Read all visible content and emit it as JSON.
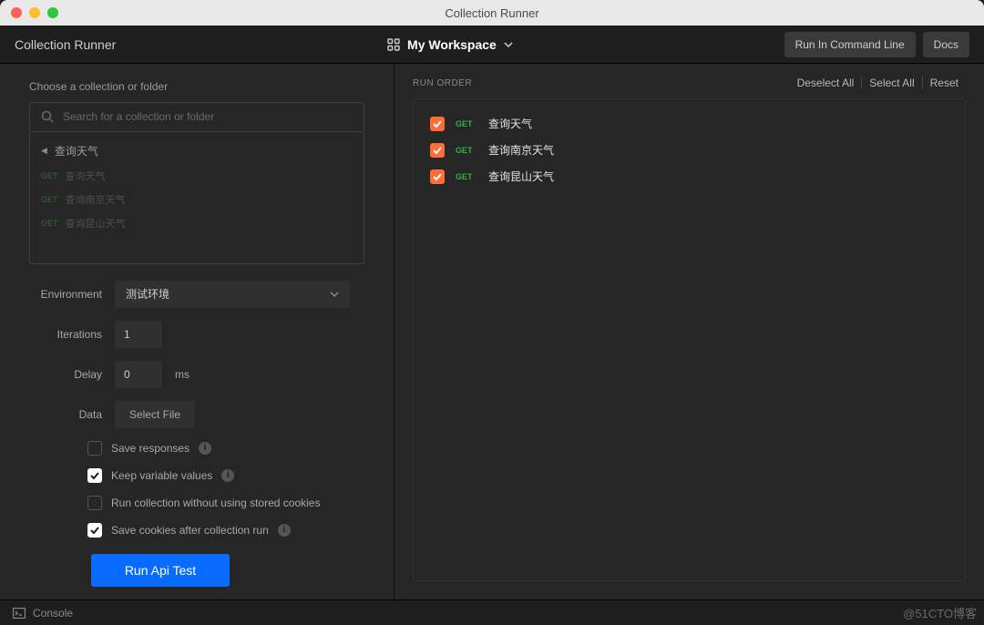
{
  "window": {
    "title": "Collection Runner"
  },
  "header": {
    "app_title": "Collection Runner",
    "workspace": "My Workspace",
    "run_cli": "Run In Command Line",
    "docs": "Docs"
  },
  "left": {
    "choose_label": "Choose a collection or folder",
    "search_placeholder": "Search for a collection or folder",
    "folder": "查询天气",
    "tree": [
      {
        "method": "GET",
        "name": "查询天气"
      },
      {
        "method": "GET",
        "name": "查询南京天气"
      },
      {
        "method": "GET",
        "name": "查询昆山天气"
      }
    ],
    "labels": {
      "environment": "Environment",
      "iterations": "Iterations",
      "delay": "Delay",
      "delay_unit": "ms",
      "data": "Data",
      "select_file": "Select File"
    },
    "values": {
      "environment": "测试环境",
      "iterations": "1",
      "delay": "0"
    },
    "options": {
      "save_responses": "Save responses",
      "keep_vars": "Keep variable values",
      "no_cookies": "Run collection without using stored cookies",
      "save_cookies": "Save cookies after collection run"
    },
    "run_button": "Run Api Test"
  },
  "right": {
    "title": "RUN ORDER",
    "deselect": "Deselect All",
    "select": "Select All",
    "reset": "Reset",
    "items": [
      {
        "method": "GET",
        "name": "查询天气"
      },
      {
        "method": "GET",
        "name": "查询南京天气"
      },
      {
        "method": "GET",
        "name": "查询昆山天气"
      }
    ]
  },
  "footer": {
    "console": "Console"
  },
  "watermark": "@51CTO博客"
}
